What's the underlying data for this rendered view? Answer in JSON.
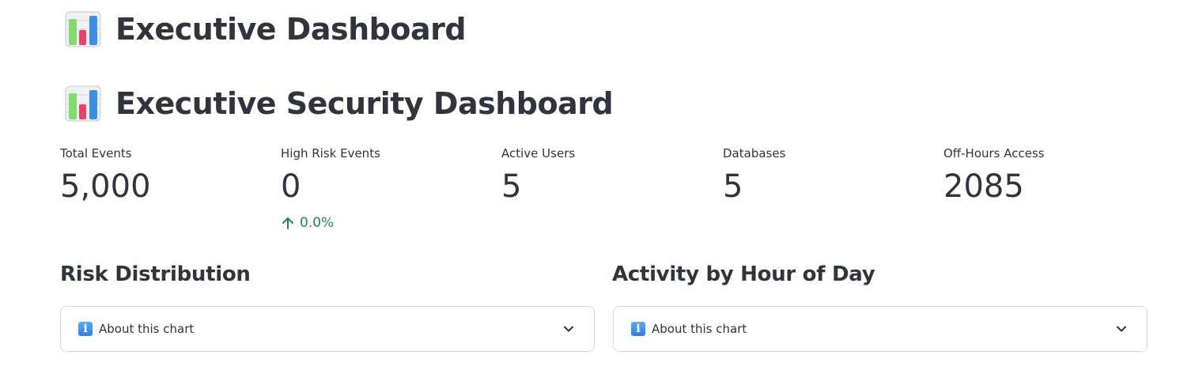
{
  "header": {
    "title": "Executive Dashboard",
    "title_icon": "bar-chart-icon"
  },
  "main": {
    "title": "Executive Security Dashboard",
    "title_icon": "bar-chart-icon",
    "metrics": [
      {
        "label": "Total Events",
        "value": "5,000"
      },
      {
        "label": "High Risk Events",
        "value": "0",
        "delta": "0.0%",
        "delta_direction": "up",
        "delta_color": "#1b8c4a"
      },
      {
        "label": "Active Users",
        "value": "5"
      },
      {
        "label": "Databases",
        "value": "5"
      },
      {
        "label": "Off-Hours Access",
        "value": "2085"
      }
    ],
    "sections": [
      {
        "heading": "Risk Distribution",
        "expander_label": "About this chart",
        "expander_icon": "info-icon"
      },
      {
        "heading": "Activity by Hour of Day",
        "expander_label": "About this chart",
        "expander_icon": "info-icon"
      }
    ]
  }
}
